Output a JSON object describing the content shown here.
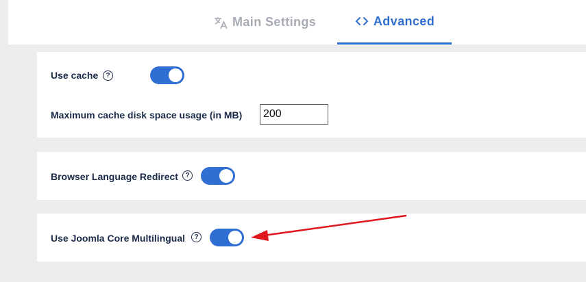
{
  "tabs": [
    {
      "label": "Main Settings",
      "icon": "translate-icon",
      "active": false
    },
    {
      "label": "Advanced",
      "icon": "code-icon",
      "active": true
    }
  ],
  "settings": {
    "use_cache": {
      "label": "Use cache",
      "help": "?",
      "enabled": true
    },
    "max_cache": {
      "label": "Maximum cache disk space usage (in MB)",
      "value": "200"
    },
    "browser_redirect": {
      "label": "Browser Language Redirect",
      "help": "?",
      "enabled": true
    },
    "joomla_multilingual": {
      "label": "Use Joomla Core Multilingual",
      "help": "?",
      "enabled": true
    }
  },
  "colors": {
    "accent": "#2f6fd4",
    "annotation_arrow": "#e0161e",
    "inactive_tab": "#a7abb3"
  }
}
